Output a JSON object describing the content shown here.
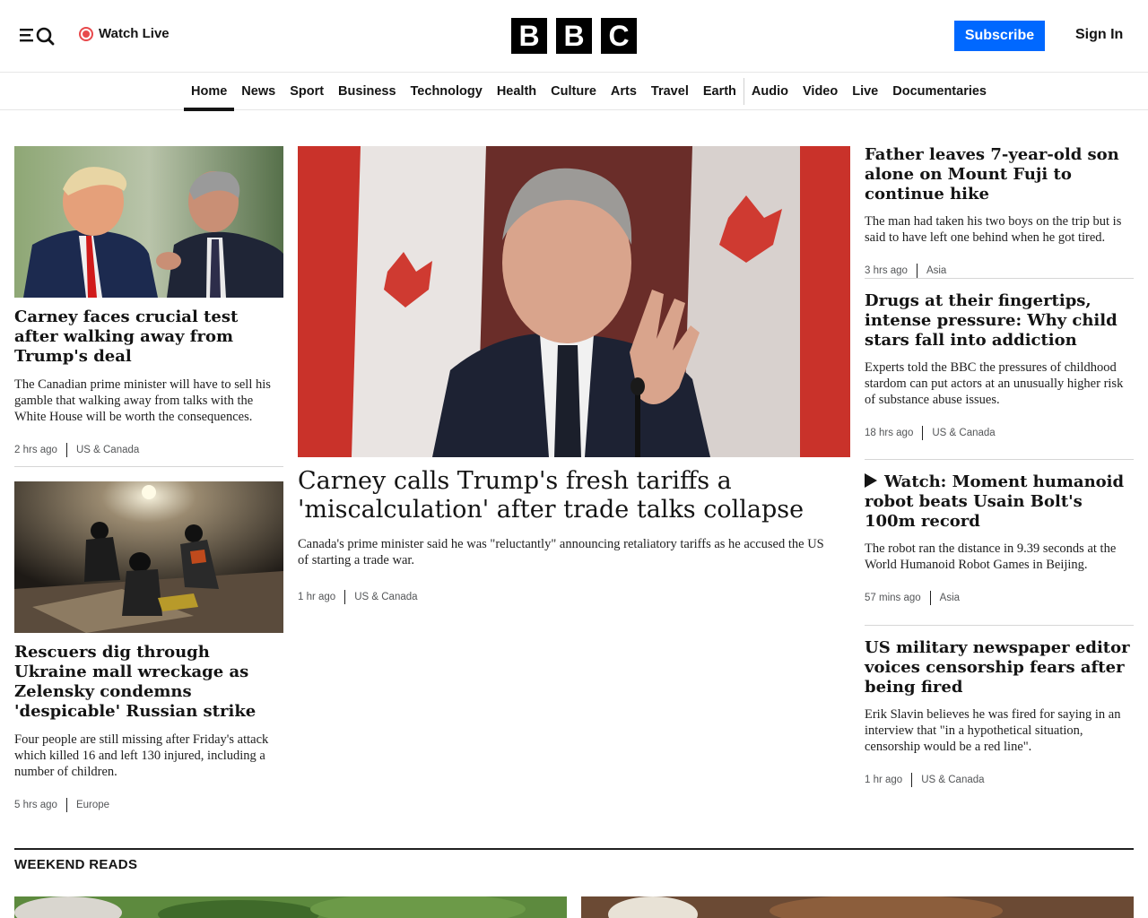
{
  "header": {
    "watch_live": "Watch Live",
    "logo_letters": [
      "B",
      "B",
      "C"
    ],
    "subscribe": "Subscribe",
    "sign_in": "Sign In"
  },
  "nav": {
    "items": [
      "Home",
      "News",
      "Sport",
      "Business",
      "Technology",
      "Health",
      "Culture",
      "Arts",
      "Travel",
      "Earth",
      "Audio",
      "Video",
      "Live",
      "Documentaries"
    ],
    "active": "Home"
  },
  "left": {
    "story1": {
      "headline": "Carney faces crucial test after walking away from Trump's deal",
      "summary": "The Canadian prime minister will have to sell his gamble that walking away from talks with the White House will be worth the consequences.",
      "time": "2 hrs ago",
      "section": "US & Canada"
    },
    "story2": {
      "headline": "Rescuers dig through Ukraine mall wreckage as Zelensky condemns 'despicable' Russian strike",
      "summary": "Four people are still missing after Friday's attack which killed 16 and left 130 injured, including a number of children.",
      "time": "5 hrs ago",
      "section": "Europe"
    }
  },
  "lead": {
    "headline": "Carney calls Trump's fresh tariffs a 'miscalculation' after trade talks collapse",
    "summary": "Canada's prime minister said he was \"reluctantly\" announcing retaliatory tariffs as he accused the US of starting a trade war.",
    "time": "1 hr ago",
    "section": "US & Canada"
  },
  "right": [
    {
      "headline": "Father leaves 7-year-old son alone on Mount Fuji to continue hike",
      "summary": "The man had taken his two boys on the trip but is said to have left one behind when he got tired.",
      "time": "3 hrs ago",
      "section": "Asia"
    },
    {
      "headline": "Drugs at their fingertips, intense pressure: Why child stars fall into addiction",
      "summary": "Experts told the BBC the pressures of childhood stardom can put actors at an unusually higher risk of substance abuse issues.",
      "time": "18 hrs ago",
      "section": "US & Canada"
    },
    {
      "headline": "Watch: Moment humanoid robot beats Usain Bolt's 100m record",
      "summary": "The robot ran the distance in 9.39 seconds at the World Humanoid Robot Games in Beijing.",
      "time": "57 mins ago",
      "section": "Asia"
    },
    {
      "headline": "US military newspaper editor voices censorship fears after being fired",
      "summary": "Erik Slavin believes he was fired for saying in an interview that \"in a hypothetical situation, censorship would be a red line\".",
      "time": "1 hr ago",
      "section": "US & Canada"
    }
  ],
  "weekend": {
    "title": "WEEKEND READS"
  },
  "colors": {
    "accent_blue": "#0068ff",
    "live_red": "#e8494c",
    "text": "#141414"
  }
}
